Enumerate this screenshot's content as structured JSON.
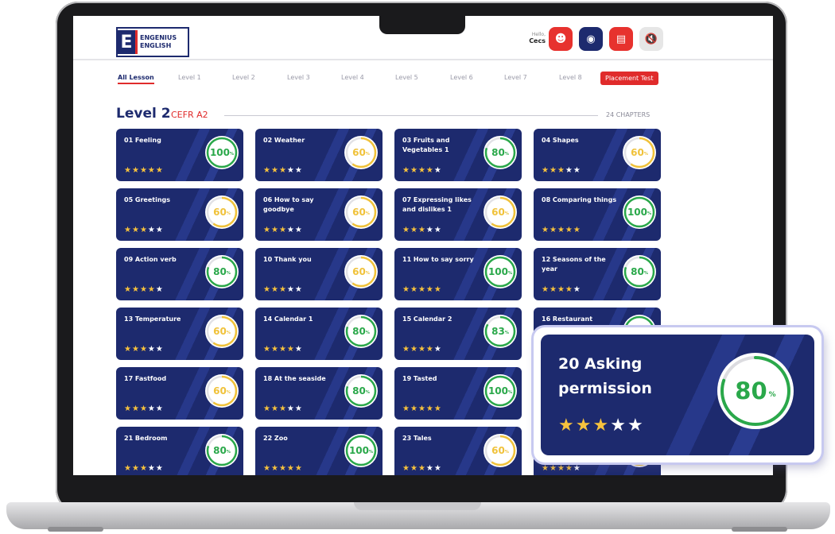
{
  "header": {
    "logo_mark": "E",
    "logo_line1": "ENGENIUS",
    "logo_line2": "ENGLISH",
    "greeting": "Hello,",
    "username": "Cecs"
  },
  "tabs": [
    {
      "label": "All Lesson",
      "active": true
    },
    {
      "label": "Level 1"
    },
    {
      "label": "Level 2"
    },
    {
      "label": "Level 3"
    },
    {
      "label": "Level 4"
    },
    {
      "label": "Level 5"
    },
    {
      "label": "Level 6"
    },
    {
      "label": "Level 7"
    },
    {
      "label": "Level 8"
    },
    {
      "label": "Placement Test",
      "highlight": true
    }
  ],
  "level": {
    "title": "Level 2",
    "cefr": "CEFR A2",
    "chapters": "24 CHAPTERS"
  },
  "colors": {
    "navy": "#1d2a6e",
    "red": "#e02b2b",
    "green_progress": "#2aa84a",
    "yellow_progress": "#f0c23a",
    "star": "#f6c23e"
  },
  "lessons": [
    {
      "title": "01 Feeling",
      "percent": 100,
      "stars": 5
    },
    {
      "title": "02 Weather",
      "percent": 60,
      "stars": 3
    },
    {
      "title": "03 Fruits and Vegetables 1",
      "percent": 80,
      "stars": 4
    },
    {
      "title": "04 Shapes",
      "percent": 60,
      "stars": 3
    },
    {
      "title": "05 Greetings",
      "percent": 60,
      "stars": 3
    },
    {
      "title": "06 How to say goodbye",
      "percent": 60,
      "stars": 3
    },
    {
      "title": "07 Expressing likes and dislikes 1",
      "percent": 60,
      "stars": 3
    },
    {
      "title": "08 Comparing things",
      "percent": 100,
      "stars": 5
    },
    {
      "title": "09 Action verb",
      "percent": 80,
      "stars": 4
    },
    {
      "title": "10 Thank you",
      "percent": 60,
      "stars": 3
    },
    {
      "title": "11 How to say sorry",
      "percent": 100,
      "stars": 5
    },
    {
      "title": "12 Seasons of the year",
      "percent": 80,
      "stars": 4
    },
    {
      "title": "13 Temperature",
      "percent": 60,
      "stars": 3
    },
    {
      "title": "14 Calendar 1",
      "percent": 80,
      "stars": 4
    },
    {
      "title": "15 Calendar 2",
      "percent": 83,
      "stars": 4
    },
    {
      "title": "16 Restaurant",
      "percent": 100,
      "stars": 4
    },
    {
      "title": "17 Fastfood",
      "percent": 60,
      "stars": 3
    },
    {
      "title": "18 At the seaside",
      "percent": 80,
      "stars": 3
    },
    {
      "title": "19 Tasted",
      "percent": 100,
      "stars": 5
    },
    {
      "title": "",
      "percent": 80,
      "stars": 3
    },
    {
      "title": "21 Bedroom",
      "percent": 80,
      "stars": 3
    },
    {
      "title": "22 Zoo",
      "percent": 100,
      "stars": 5
    },
    {
      "title": "23 Tales",
      "percent": 60,
      "stars": 3
    },
    {
      "title": "",
      "percent": 60,
      "stars": 4
    }
  ],
  "popup": {
    "title": "20 Asking permission",
    "percent": 80,
    "stars": 3,
    "percent_sign": "%"
  }
}
